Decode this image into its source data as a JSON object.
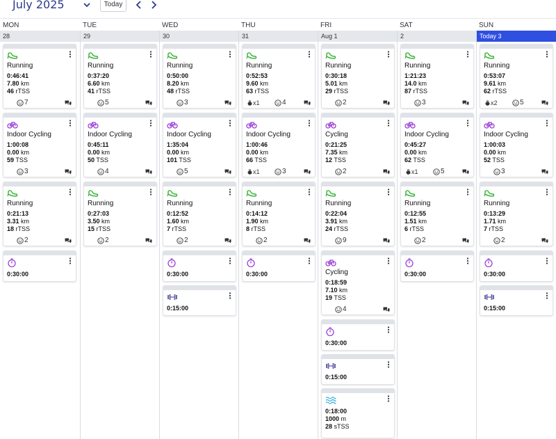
{
  "header": {
    "month": "July 2025",
    "today_label": "Today"
  },
  "weekdays": [
    "MON",
    "TUE",
    "WED",
    "THU",
    "FRI",
    "SAT",
    "SUN"
  ],
  "dates": [
    "28",
    "29",
    "30",
    "31",
    "Aug 1",
    "2",
    "Today 3"
  ],
  "colors": {
    "today_bar": "#2f4fe0",
    "run_icon": "#34b233",
    "bike_icon": "#9b3fd6",
    "timer_icon": "#9b3fd6",
    "strength_icon": "#6b6bb0",
    "swim_icon": "#28a6d8"
  },
  "columns": [
    {
      "cards": [
        {
          "type": "run",
          "title": "Running",
          "time": "0:46:41",
          "dist_val": "7.80",
          "dist_unit": "km",
          "load_val": "46",
          "load_unit": "rTSS",
          "face": "7",
          "chat": true
        },
        {
          "type": "bike",
          "title": "Indoor Cycling",
          "time": "1:00:08",
          "dist_val": "0.00",
          "dist_unit": "km",
          "load_val": "59",
          "load_unit": "TSS",
          "face": "3",
          "chat": true
        },
        {
          "type": "run",
          "title": "Running",
          "time": "0:21:13",
          "dist_val": "3.31",
          "dist_unit": "km",
          "load_val": "18",
          "load_unit": "rTSS",
          "face": "2",
          "chat": true
        },
        {
          "type": "timer",
          "time": "0:30:00"
        }
      ]
    },
    {
      "cards": [
        {
          "type": "run",
          "title": "Running",
          "time": "0:37:20",
          "dist_val": "6.60",
          "dist_unit": "km",
          "load_val": "41",
          "load_unit": "rTSS",
          "face": "5",
          "chat": true
        },
        {
          "type": "bike",
          "title": "Indoor Cycling",
          "time": "0:45:11",
          "dist_val": "0.00",
          "dist_unit": "km",
          "load_val": "50",
          "load_unit": "TSS",
          "face": "4",
          "chat": true
        },
        {
          "type": "run",
          "title": "Running",
          "time": "0:27:03",
          "dist_val": "3.50",
          "dist_unit": "km",
          "load_val": "15",
          "load_unit": "rTSS",
          "face": "2",
          "chat": true
        }
      ]
    },
    {
      "cards": [
        {
          "type": "run",
          "title": "Running",
          "time": "0:50:00",
          "dist_val": "8.20",
          "dist_unit": "km",
          "load_val": "48",
          "load_unit": "rTSS",
          "face": "3",
          "chat": true
        },
        {
          "type": "bike",
          "title": "Indoor Cycling",
          "time": "1:35:04",
          "dist_val": "0.00",
          "dist_unit": "km",
          "load_val": "101",
          "load_unit": "TSS",
          "face": "5",
          "chat": true
        },
        {
          "type": "run",
          "title": "Running",
          "time": "0:12:52",
          "dist_val": "1.60",
          "dist_unit": "km",
          "load_val": "7",
          "load_unit": "rTSS",
          "face": "2",
          "chat": true
        },
        {
          "type": "timer",
          "time": "0:30:00"
        },
        {
          "type": "strength",
          "time": "0:15:00"
        }
      ]
    },
    {
      "cards": [
        {
          "type": "run",
          "title": "Running",
          "time": "0:52:53",
          "dist_val": "9.60",
          "dist_unit": "km",
          "load_val": "63",
          "load_unit": "rTSS",
          "kb": "x1",
          "face": "4",
          "chat": true
        },
        {
          "type": "bike",
          "title": "Indoor Cycling",
          "time": "1:00:46",
          "dist_val": "0.00",
          "dist_unit": "km",
          "load_val": "66",
          "load_unit": "TSS",
          "kb": "x1",
          "face": "3",
          "chat": true
        },
        {
          "type": "run",
          "title": "Running",
          "time": "0:14:12",
          "dist_val": "1.90",
          "dist_unit": "km",
          "load_val": "8",
          "load_unit": "rTSS",
          "face": "2",
          "chat": true
        },
        {
          "type": "timer",
          "time": "0:30:00"
        }
      ]
    },
    {
      "cards": [
        {
          "type": "run",
          "title": "Running",
          "time": "0:30:18",
          "dist_val": "5.01",
          "dist_unit": "km",
          "load_val": "29",
          "load_unit": "rTSS",
          "face": "2",
          "chat": true
        },
        {
          "type": "bike",
          "title": "Cycling",
          "time": "0:21:25",
          "dist_val": "7.35",
          "dist_unit": "km",
          "load_val": "12",
          "load_unit": "TSS",
          "face": "2",
          "chat": true
        },
        {
          "type": "run",
          "title": "Running",
          "time": "0:22:04",
          "dist_val": "3.91",
          "dist_unit": "km",
          "load_val": "24",
          "load_unit": "rTSS",
          "face": "9",
          "chat": true
        },
        {
          "type": "bike",
          "title": "Cycling",
          "time": "0:18:59",
          "dist_val": "7.10",
          "dist_unit": "km",
          "load_val": "19",
          "load_unit": "TSS",
          "face": "4",
          "chat": true
        },
        {
          "type": "timer",
          "time": "0:30:00"
        },
        {
          "type": "strength",
          "time": "0:15:00"
        },
        {
          "type": "swim",
          "time": "0:18:00",
          "dist_val": "1000",
          "dist_unit": "m",
          "load_val": "28",
          "load_unit": "sTSS"
        }
      ]
    },
    {
      "cards": [
        {
          "type": "run",
          "title": "Running",
          "time": "1:21:23",
          "dist_val": "14.0",
          "dist_unit": "km",
          "load_val": "87",
          "load_unit": "rTSS",
          "face": "3",
          "chat": true
        },
        {
          "type": "bike",
          "title": "Indoor Cycling",
          "time": "0:45:27",
          "dist_val": "0.00",
          "dist_unit": "km",
          "load_val": "62",
          "load_unit": "TSS",
          "kb": "x1",
          "face": "5",
          "chat": true
        },
        {
          "type": "run",
          "title": "Running",
          "time": "0:12:55",
          "dist_val": "1.51",
          "dist_unit": "km",
          "load_val": "6",
          "load_unit": "rTSS",
          "face": "2",
          "chat": true
        },
        {
          "type": "timer",
          "time": "0:30:00"
        }
      ]
    },
    {
      "cards": [
        {
          "type": "run",
          "title": "Running",
          "time": "0:53:07",
          "dist_val": "9.61",
          "dist_unit": "km",
          "load_val": "62",
          "load_unit": "rTSS",
          "kb": "x2",
          "face": "5",
          "chat": true
        },
        {
          "type": "bike",
          "title": "Indoor Cycling",
          "time": "1:00:03",
          "dist_val": "0.00",
          "dist_unit": "km",
          "load_val": "52",
          "load_unit": "TSS",
          "face": "3",
          "chat": true
        },
        {
          "type": "run",
          "title": "Running",
          "time": "0:13:29",
          "dist_val": "1.71",
          "dist_unit": "km",
          "load_val": "7",
          "load_unit": "rTSS",
          "face": "2",
          "chat": true
        },
        {
          "type": "timer",
          "time": "0:30:00"
        },
        {
          "type": "strength",
          "time": "0:15:00"
        }
      ]
    }
  ]
}
